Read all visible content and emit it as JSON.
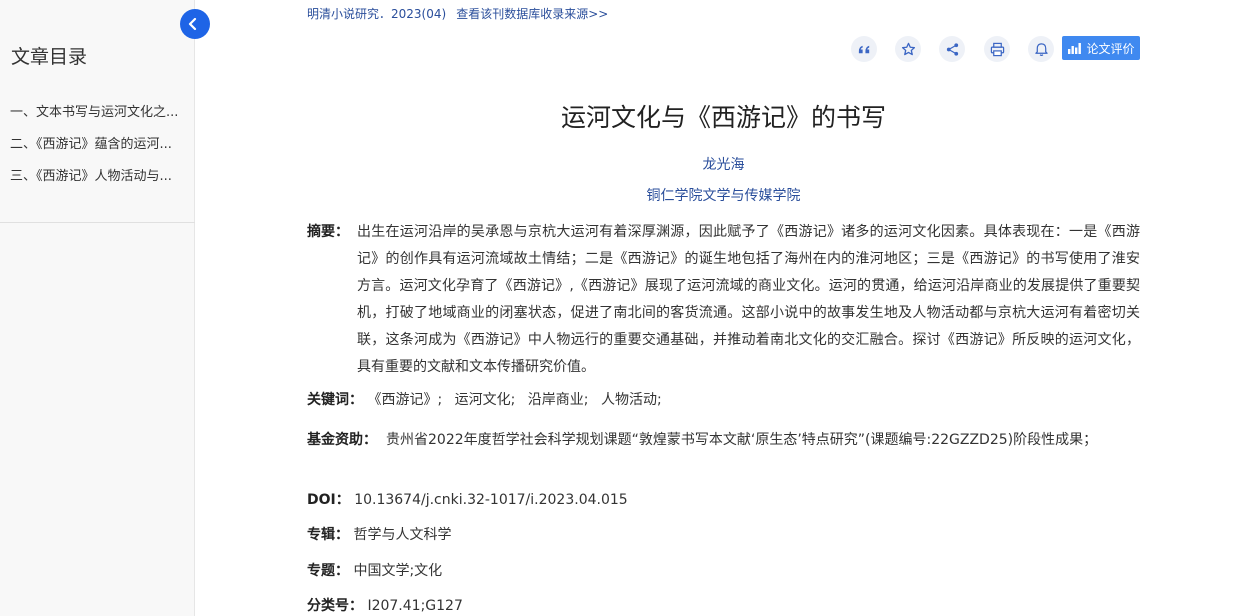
{
  "sidebar": {
    "title": "文章目录",
    "toc": [
      "一、文本书写与运河文化之...",
      "二、《西游记》蕴含的运河...",
      "三、《西游记》人物活动与..."
    ]
  },
  "source": {
    "journal": "明清小说研究．2023(04)",
    "link": "查看该刊数据库收录来源>>"
  },
  "toolbar": {
    "review_label": "论文评价"
  },
  "article": {
    "title": "运河文化与《西游记》的书写",
    "author": "龙光海",
    "affiliation": "铜仁学院文学与传媒学院",
    "abstract_label": "摘要：",
    "abstract": "出生在运河沿岸的吴承恩与京杭大运河有着深厚渊源，因此赋予了《西游记》诸多的运河文化因素。具体表现在：一是《西游记》的创作具有运河流域故土情结；二是《西游记》的诞生地包括了海州在内的淮河地区；三是《西游记》的书写使用了淮安方言。运河文化孕育了《西游记》,《西游记》展现了运河流域的商业文化。运河的贯通，给运河沿岸商业的发展提供了重要契机，打破了地域商业的闭塞状态，促进了南北间的客货流通。这部小说中的故事发生地及人物活动都与京杭大运河有着密切关联，这条河成为《西游记》中人物远行的重要交通基础，并推动着南北文化的交汇融合。探讨《西游记》所反映的运河文化，具有重要的文献和文本传播研究价值。",
    "keywords_label": "关键词：",
    "keywords": [
      "《西游记》;",
      "运河文化;",
      "沿岸商业;",
      "人物活动;"
    ],
    "fund_label": "基金资助：",
    "fund": "贵州省2022年度哲学社会科学规划课题“敦煌蒙书写本文献‘原生态’特点研究”(课题编号:22GZZD25)阶段性成果；",
    "doi_label": "DOI：",
    "doi": "10.13674/j.cnki.32-1017/i.2023.04.015",
    "album_label": "专辑：",
    "album": "哲学与人文科学",
    "topic_label": "专题：",
    "topic": "中国文学;文化",
    "class_label": "分类号：",
    "class": "I207.41;G127"
  },
  "colors": {
    "link": "#2a4e9b",
    "accent": "#1e64e6",
    "review_button": "#3f89f0",
    "icon_bg": "#eef1f7"
  },
  "icons": [
    "quote-icon",
    "star-icon",
    "share-icon",
    "print-icon",
    "bell-icon",
    "bar-chart-icon",
    "chevron-left-icon"
  ]
}
